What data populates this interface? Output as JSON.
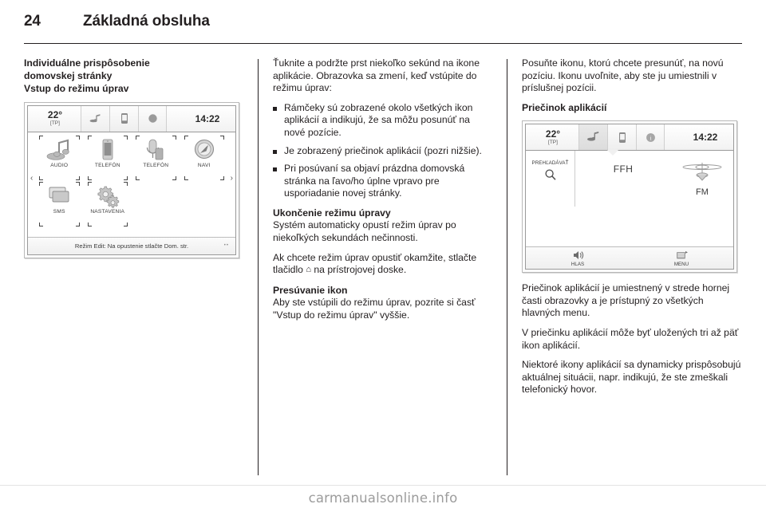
{
  "header": {
    "page_number": "24",
    "chapter_title": "Základná obsluha"
  },
  "left_column": {
    "heading_line1": "Individuálne prispôsobenie",
    "heading_line2": "domovskej stránky",
    "subheading": "Vstup do režimu úprav",
    "screenshot": {
      "name": "home-screen-edit-mode",
      "status_bar": {
        "temperature": "22°",
        "tp_indicator": "[TP]",
        "time": "14:22",
        "tray_icons": [
          "audio-icon",
          "phone-icon",
          "record-icon"
        ]
      },
      "apps": [
        {
          "label": "AUDIO",
          "icon": "audio-note-icon"
        },
        {
          "label": "TELEFÓN",
          "icon": "mobile-phone-icon"
        },
        {
          "label": "TELEFÓN",
          "icon": "microphone-phone-icon"
        },
        {
          "label": "NAVI",
          "icon": "compass-icon"
        },
        {
          "label": "SMS",
          "icon": "message-icon"
        },
        {
          "label": "NASTAVENIA",
          "icon": "gears-icon"
        }
      ],
      "page_arrow_left": "‹",
      "page_arrow_right": "›",
      "hint_text": "Režim Edit: Na opustenie stlačte Dom. str.",
      "page_dots": "••"
    }
  },
  "middle_column": {
    "intro_p1": "Ťuknite a podržte prst niekoľko sekúnd na ikone aplikácie. Obrazovka sa zmení, keď vstúpite do režimu úprav:",
    "bullets": [
      "Rámčeky sú zobrazené okolo všetkých ikon aplikácií a indikujú, že sa môžu posunúť na nové pozície.",
      "Je zobrazený priečinok aplikácií (pozri nižšie).",
      "Pri posúvaní sa objaví prázdna domovská stránka na ľavo/ho úplne vpravo pre usporiadanie novej stránky."
    ],
    "heading_exit": "Ukončenie režimu úpravy",
    "exit_p1": "Systém automaticky opustí režim úprav po niekoľkých sekundách nečinnosti.",
    "exit_p2_before": "Ak chcete režim úprav opustiť okamžite, stlačte tlačidlo ",
    "exit_p2_glyph": "⌂",
    "exit_p2_after": " na prístrojovej doske.",
    "heading_move": "Presúvanie ikon",
    "move_p1": "Aby ste vstúpili do režimu úprav, pozrite si časť \"Vstup do režimu úprav\" vyššie."
  },
  "right_column": {
    "move_p2": "Posuňte ikonu, ktorú chcete presunúť, na novú pozíciu. Ikonu uvoľnite, aby ste ju umiestnili v príslušnej pozícii.",
    "heading_folder": "Priečinok aplikácií",
    "screenshot": {
      "name": "radio-screen",
      "status_bar": {
        "temperature": "22°",
        "tp_indicator": "[TP]",
        "time": "14:22",
        "tray_icons": [
          "audio-icon",
          "phone-icon",
          "info-icon"
        ]
      },
      "browse_label": "PREHĽADÁVAŤ",
      "browse_icon": "magnifier-icon",
      "station_name": "FFH",
      "band_label": "FM",
      "band_icon": "tuner-dial-icon",
      "footer_buttons": [
        {
          "label": "HLAS",
          "icon": "voice-icon"
        },
        {
          "label": "MENU",
          "icon": "menu-icon"
        }
      ]
    },
    "folder_p1": "Priečinok aplikácií je umiestnený v strede hornej časti obrazovky a je prístupný zo všetkých hlavných menu.",
    "folder_p2": "V priečinku aplikácií môže byť uložených tri až päť ikon aplikácií.",
    "folder_p3": "Niektoré ikony aplikácií sa dynamicky prispôsobujú aktuálnej situácii, napr. indikujú, že ste zmeškali telefonický hovor."
  },
  "footer": {
    "watermark": "carmanualsonline.info"
  }
}
